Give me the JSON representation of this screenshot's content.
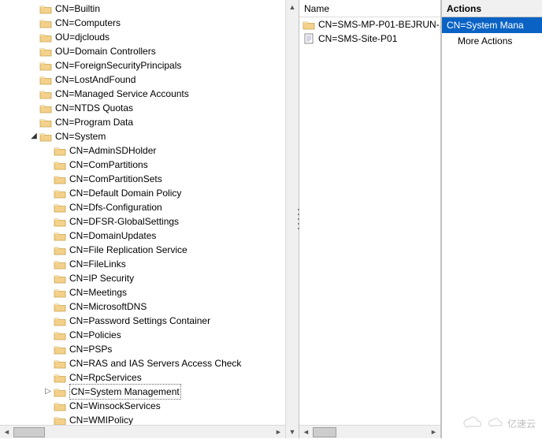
{
  "tree": {
    "selected_index": 23,
    "items": [
      {
        "indent": 2,
        "toggle": "",
        "label": "CN=Builtin"
      },
      {
        "indent": 2,
        "toggle": "",
        "label": "CN=Computers"
      },
      {
        "indent": 2,
        "toggle": "",
        "label": "OU=djclouds"
      },
      {
        "indent": 2,
        "toggle": "",
        "label": "OU=Domain Controllers"
      },
      {
        "indent": 2,
        "toggle": "",
        "label": "CN=ForeignSecurityPrincipals"
      },
      {
        "indent": 2,
        "toggle": "",
        "label": "CN=LostAndFound"
      },
      {
        "indent": 2,
        "toggle": "",
        "label": "CN=Managed Service Accounts"
      },
      {
        "indent": 2,
        "toggle": "",
        "label": "CN=NTDS Quotas"
      },
      {
        "indent": 2,
        "toggle": "",
        "label": "CN=Program Data"
      },
      {
        "indent": 2,
        "toggle": "expanded",
        "label": "CN=System"
      },
      {
        "indent": 3,
        "toggle": "",
        "label": "CN=AdminSDHolder"
      },
      {
        "indent": 3,
        "toggle": "",
        "label": "CN=ComPartitions"
      },
      {
        "indent": 3,
        "toggle": "",
        "label": "CN=ComPartitionSets"
      },
      {
        "indent": 3,
        "toggle": "",
        "label": "CN=Default Domain Policy"
      },
      {
        "indent": 3,
        "toggle": "",
        "label": "CN=Dfs-Configuration"
      },
      {
        "indent": 3,
        "toggle": "",
        "label": "CN=DFSR-GlobalSettings"
      },
      {
        "indent": 3,
        "toggle": "",
        "label": "CN=DomainUpdates"
      },
      {
        "indent": 3,
        "toggle": "",
        "label": "CN=File Replication Service"
      },
      {
        "indent": 3,
        "toggle": "",
        "label": "CN=FileLinks"
      },
      {
        "indent": 3,
        "toggle": "",
        "label": "CN=IP Security"
      },
      {
        "indent": 3,
        "toggle": "",
        "label": "CN=Meetings"
      },
      {
        "indent": 3,
        "toggle": "",
        "label": "CN=MicrosoftDNS"
      },
      {
        "indent": 3,
        "toggle": "",
        "label": "CN=Password Settings Container"
      },
      {
        "indent": 3,
        "toggle": "",
        "label": "CN=Policies"
      },
      {
        "indent": 3,
        "toggle": "",
        "label": "CN=PSPs"
      },
      {
        "indent": 3,
        "toggle": "",
        "label": "CN=RAS and IAS Servers Access Check"
      },
      {
        "indent": 3,
        "toggle": "",
        "label": "CN=RpcServices"
      },
      {
        "indent": 3,
        "toggle": "collapsed",
        "label": "CN=System Management",
        "selected": true
      },
      {
        "indent": 3,
        "toggle": "",
        "label": "CN=WinsockServices"
      },
      {
        "indent": 3,
        "toggle": "",
        "label": "CN=WMIPolicy"
      }
    ]
  },
  "detail": {
    "column_header": "Name",
    "rows": [
      {
        "type": "folder",
        "label": "CN=SMS-MP-P01-BEJRUN-..."
      },
      {
        "type": "doc",
        "label": "CN=SMS-Site-P01"
      }
    ]
  },
  "actions": {
    "title": "Actions",
    "selected": "CN=System Mana",
    "more": "More Actions"
  },
  "watermark": "亿速云"
}
